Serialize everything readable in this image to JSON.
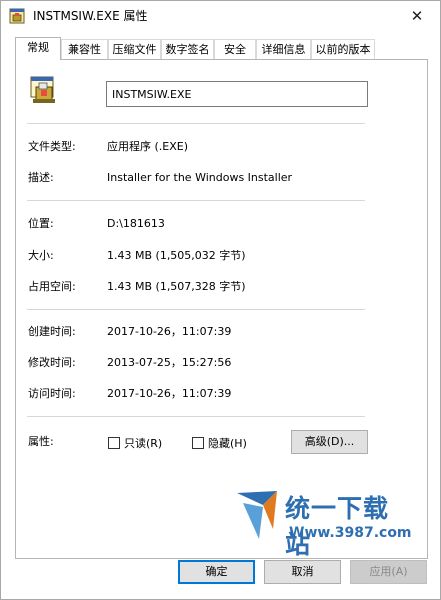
{
  "window": {
    "title": "INSTMSIW.EXE 属性",
    "close_glyph": "✕"
  },
  "tabs": [
    {
      "label": "常规",
      "active": true
    },
    {
      "label": "兼容性"
    },
    {
      "label": "压缩文件"
    },
    {
      "label": "数字签名"
    },
    {
      "label": "安全"
    },
    {
      "label": "详细信息"
    },
    {
      "label": "以前的版本"
    }
  ],
  "file": {
    "name": "INSTMSIW.EXE",
    "icon": "installer-icon"
  },
  "fields": {
    "type_label": "文件类型:",
    "type_value": "应用程序 (.EXE)",
    "desc_label": "描述:",
    "desc_value": "Installer for the Windows Installer",
    "location_label": "位置:",
    "location_value": "D:\\181613",
    "size_label": "大小:",
    "size_value": "1.43 MB (1,505,032 字节)",
    "disk_label": "占用空间:",
    "disk_value": "1.43 MB (1,507,328 字节)",
    "created_label": "创建时间:",
    "created_value": "2017-10-26，11:07:39",
    "modified_label": "修改时间:",
    "modified_value": "2013-07-25，15:27:56",
    "accessed_label": "访问时间:",
    "accessed_value": "2017-10-26，11:07:39",
    "attr_label": "属性:"
  },
  "attributes": {
    "readonly_label": "只读(R)",
    "readonly_checked": false,
    "hidden_label": "隐藏(H)",
    "hidden_checked": false,
    "advanced_label": "高级(D)..."
  },
  "buttons": {
    "ok": "确定",
    "cancel": "取消",
    "apply": "应用(A)"
  },
  "watermark": {
    "text": "统一下载站",
    "url": "Www.3987.com"
  },
  "colors": {
    "accent": "#0078d7",
    "watermark": "#2d6fb0"
  }
}
